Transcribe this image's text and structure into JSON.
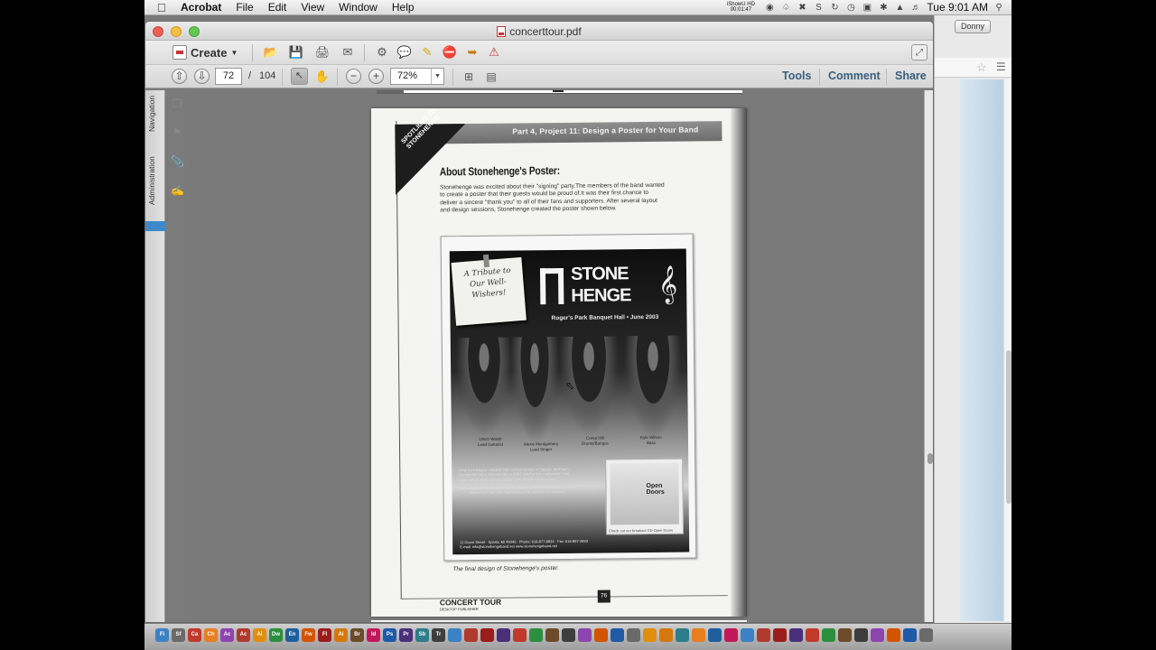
{
  "menubar": {
    "app_name": "Acrobat",
    "menus": [
      "File",
      "Edit",
      "View",
      "Window",
      "Help"
    ],
    "recorder_line1": "iShowU HD",
    "recorder_line2": "00:01:47",
    "clock": "Tue 9:01 AM"
  },
  "browser": {
    "user_button": "Donny"
  },
  "window": {
    "title": "concerttour.pdf"
  },
  "toolbar": {
    "create_label": "Create",
    "current_page": "72",
    "page_separator": "/",
    "total_pages": "104",
    "zoom_value": "72%",
    "tools_label": "Tools",
    "comment_label": "Comment",
    "share_label": "Share"
  },
  "navpane": {
    "navigation_label": "Navigation",
    "administration_label": "Administration"
  },
  "document": {
    "header": "Part 4, Project 11: Design a Poster for Your Band",
    "spotlight": "SPOTLIGHT ON STONEHENGE",
    "about_title": "About Stonehenge's Poster:",
    "about_body": "Stonehenge was excited about their \"signing\" party.The members of the band wanted to create a poster that their guests would be proud of.It was their first chance to deliver a sincere \"thank you\" to all of their fans and supporters. After several layout and design sessions, Stonehenge created the poster shown below.",
    "poster": {
      "sticky_note": "A Tribute to Our Well-Wishers!",
      "logo_line1": "STONE",
      "logo_line2": "HENGE",
      "venue": "Roger's Park Banquet Hall • June 2003",
      "members": [
        {
          "name": "Ulrich Walsh",
          "role": "Lead Guitarist"
        },
        {
          "name": "Alexis Montgomery",
          "role": "Lead Singer"
        },
        {
          "name": "Corey Hill",
          "role": "Drums/Bongos"
        },
        {
          "name": "Kyle Wilson",
          "role": "Bass"
        }
      ],
      "story_text": "How It All Began: Several high school seniors in Sparta, Michigan, formed the band Stonehenge in 2002. During the sophomore year, every detail of the band's career took off with great speed...",
      "thanks_text": "We would like to thank our family, friends, and fans for sticking by us, believing in us, and supporting us to achieve our dreams.",
      "address": "11 Grove Street · Sparta, MI 49345 · Phone: 616-877-8824 · Fax: 616-887-2893",
      "web": "E-mail: info@stonehengeband.net   www.stonehengeband.net",
      "cd_title": "Open Doors",
      "cd_caption": "Check out our breakout CD Open Doors"
    },
    "poster_caption": "The final design of Stonehenge's poster.",
    "footer_logo": "CONCERT TOUR",
    "footer_sub": "DESKTOP PUBLISHER",
    "page_number": "76"
  },
  "dock": {
    "icons": [
      "Fi",
      "Sf",
      "Ca",
      "Ch",
      "Ac",
      "Ac",
      "Ai",
      "Dw",
      "En",
      "Fw",
      "Fl",
      "Ai",
      "Br",
      "Id",
      "Ps",
      "Pr",
      "Sb",
      "Tr"
    ]
  }
}
